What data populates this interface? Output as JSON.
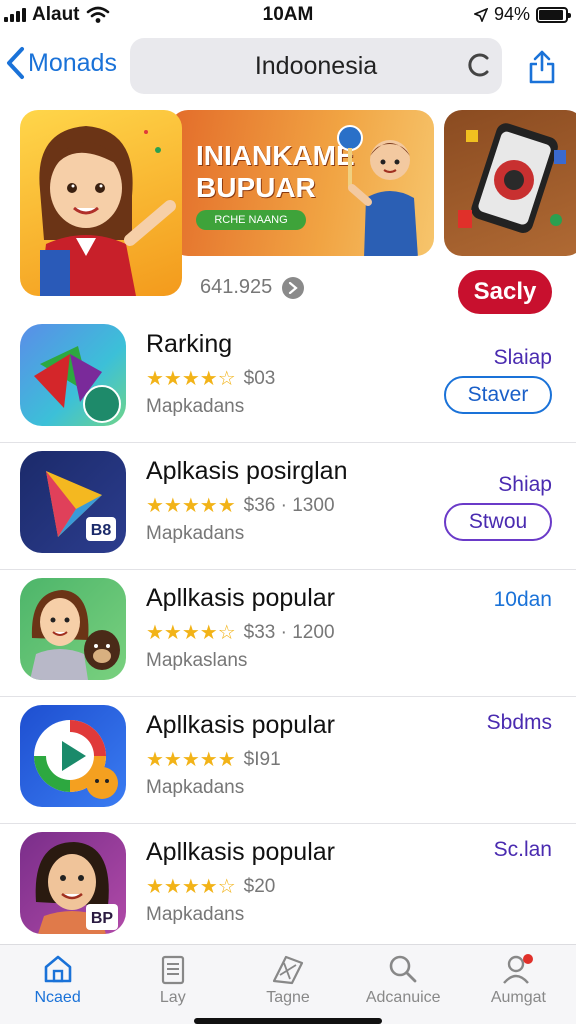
{
  "status_bar": {
    "carrier": "Alaut",
    "time": "10AM",
    "battery": "94%"
  },
  "nav": {
    "back_label": "Monads",
    "search_text": "Indoonesia"
  },
  "featured": {
    "banner_title_line1": "INIANKAME",
    "banner_title_line2": "BUPUAR",
    "banner_button": "RCHE NAANG",
    "count": "641.925",
    "sale_label": "Sacly"
  },
  "apps": [
    {
      "title": "Rarking",
      "stars": "★★★★☆",
      "price": "$03",
      "subtitle": "Mapkadans",
      "action_text": "Slaiap",
      "action_pill": "Staver",
      "icon_colors": [
        "#5a8de8",
        "#3cc0d8"
      ],
      "accent": "#e44a2a",
      "badge": ""
    },
    {
      "title": "Aplkasis posirglan",
      "stars": "★★★★★",
      "price": "$36 · 1300",
      "subtitle": "Mapkadans",
      "action_text": "Shiap",
      "action_pill": "Stwou",
      "icon_colors": [
        "#1b2a6a",
        "#2c3d8e"
      ],
      "accent": "#f4b820",
      "badge": "B8"
    },
    {
      "title": "Apllkasis popular",
      "stars": "★★★★☆",
      "price": "$33 · 1200",
      "subtitle": "Mapkaslans",
      "action_text": "10dan",
      "action_pill": "",
      "icon_colors": [
        "#4db56a",
        "#7ad17f"
      ],
      "accent": "#8a4a2a",
      "badge": ""
    },
    {
      "title": "Apllkasis popular",
      "stars": "★★★★★",
      "price": "$I91",
      "subtitle": "Mapkadans",
      "action_text": "Sbdms",
      "action_pill": "",
      "icon_colors": [
        "#1e4fd0",
        "#3a7cf2"
      ],
      "accent": "#f4a020",
      "badge": ""
    },
    {
      "title": "Apllkasis popular",
      "stars": "★★★★☆",
      "price": "$20",
      "subtitle": "Mapkadans",
      "action_text": "Sc.lan",
      "action_pill": "",
      "icon_colors": [
        "#7a2e8a",
        "#b04aa8"
      ],
      "accent": "#5a3020",
      "badge": "BP"
    }
  ],
  "tabs": [
    {
      "label": "Ncaed",
      "icon": "home-icon",
      "active": true
    },
    {
      "label": "Lay",
      "icon": "list-icon",
      "active": false
    },
    {
      "label": "Tagne",
      "icon": "games-icon",
      "active": false
    },
    {
      "label": "Adcanuice",
      "icon": "search-icon",
      "active": false
    },
    {
      "label": "Aumgat",
      "icon": "account-icon",
      "active": false
    }
  ],
  "colors": {
    "accent_blue": "#1a72d8",
    "sale_red": "#c8102e",
    "star_gold": "#f2b318",
    "action_purple": "#4a2bb0"
  }
}
